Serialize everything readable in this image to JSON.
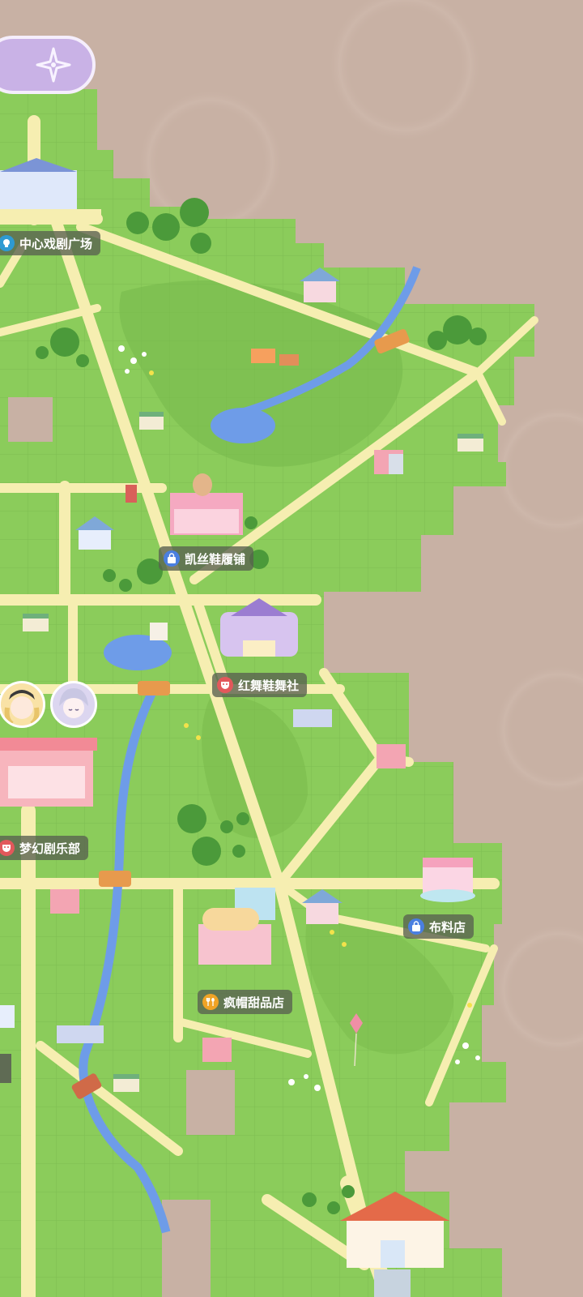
{
  "locations": [
    {
      "name": "中心戏剧广场",
      "icon": "theater-pin-icon"
    },
    {
      "name": "凯丝鞋履铺",
      "icon": "shopping-bag-icon"
    },
    {
      "name": "红舞鞋舞社",
      "icon": "drama-mask-icon"
    },
    {
      "name": "梦幻剧乐部",
      "icon": "drama-mask-icon"
    },
    {
      "name": "布料店",
      "icon": "shopping-bag-icon"
    },
    {
      "name": "疯帽甜品店",
      "icon": "fork-spoon-icon"
    }
  ],
  "back_button": {
    "icon": "compass-star-icon"
  },
  "avatars": [
    {
      "name": "blonde-girl-avatar"
    },
    {
      "name": "silver-hair-avatar"
    }
  ],
  "colors": {
    "background": "#c8b1a4",
    "grass": "#8bcc5b",
    "road": "#f6eeb1",
    "river": "#6e9ce8",
    "label_bg": "#586050",
    "back_button": "#c9b2e6"
  }
}
